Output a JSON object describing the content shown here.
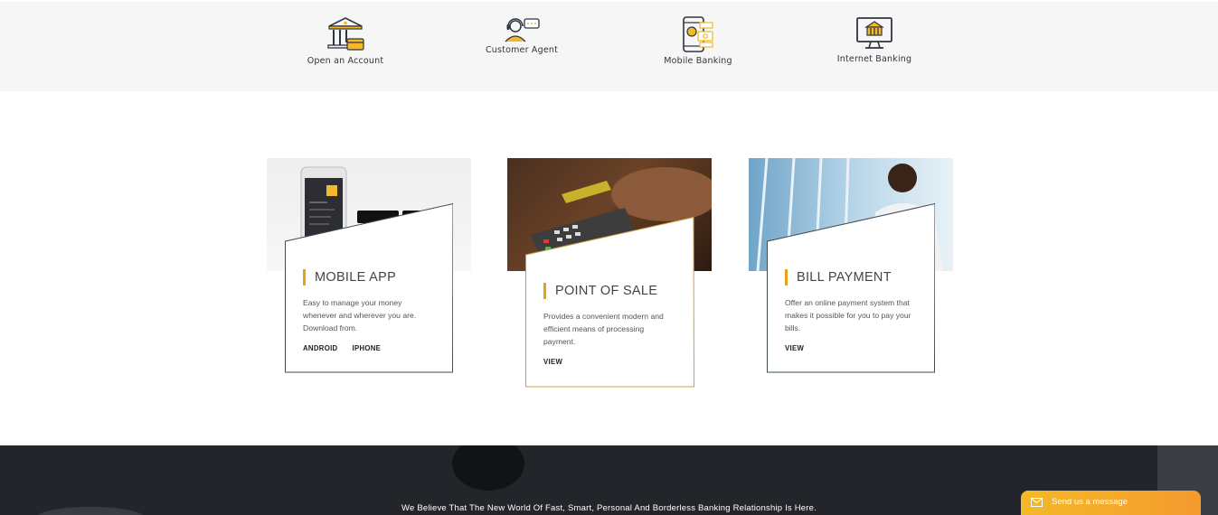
{
  "services": [
    {
      "label": "Open an Account",
      "icon": "bank-card-icon"
    },
    {
      "label": "Customer Agent",
      "icon": "headset-agent-icon"
    },
    {
      "label": "Mobile Banking",
      "icon": "mobile-phone-icon"
    },
    {
      "label": "Internet Banking",
      "icon": "monitor-bank-icon"
    }
  ],
  "cards": [
    {
      "title": "MOBILE APP",
      "desc": "Easy to manage your money whenever and wherever you are. Download from.",
      "links": [
        "ANDROID",
        "IPHONE"
      ]
    },
    {
      "title": "POINT OF SALE",
      "desc": "Provides a convenient modern and efficient means of processing payment.",
      "links": [
        "VIEW"
      ]
    },
    {
      "title": "BILL PAYMENT",
      "desc": "Offer an online payment system that makes it possible for you to pay your bills.",
      "links": [
        "VIEW"
      ]
    }
  ],
  "footer": {
    "tagline": "We Believe That The New World Of Fast, Smart, Personal And Borderless Banking Relationship Is Here."
  },
  "chat": {
    "label": "Send us a message"
  },
  "colors": {
    "accent": "#e5a21a",
    "dark": "#23252b",
    "icon": "#2f3640"
  }
}
